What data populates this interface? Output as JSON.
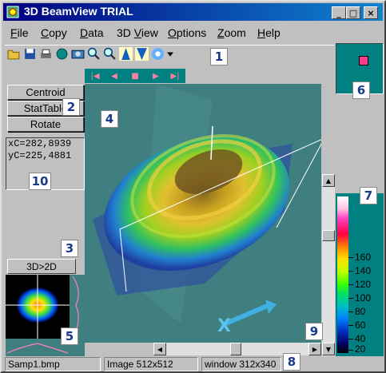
{
  "window": {
    "title": "3D BeamView TRIAL",
    "minimize": "_",
    "maximize": "□",
    "close": "×"
  },
  "menu": [
    "File",
    "Copy",
    "Data",
    "3D View",
    "Options",
    "Zoom",
    "Help"
  ],
  "menu_access_keys": [
    "F",
    "C",
    "D",
    "V",
    "O",
    "Z",
    "H"
  ],
  "toolbar": {
    "icons": [
      "open-icon",
      "save-icon",
      "print-icon",
      "globe-icon",
      "camera-icon",
      "zoom-in-icon",
      "zoom-out-icon",
      "beam-up-icon",
      "beam-split-icon",
      "star-icon",
      "dropdown-arrow-icon"
    ]
  },
  "callouts": [
    "1",
    "2",
    "3",
    "4",
    "5",
    "6",
    "7",
    "8",
    "9",
    "10"
  ],
  "left_panel": {
    "centroid": "Centroid",
    "stattable": "StatTable",
    "rotate": "Rotate",
    "xc": "xC=282,8939",
    "yc": "yC=225,4881",
    "btn_3d2d": "3D>2D"
  },
  "playback": {
    "first": "|◀",
    "prev": "◀",
    "stop": "■",
    "next": "▶",
    "last": "▶|"
  },
  "legend": {
    "labels": [
      "160",
      "140",
      "120",
      "100",
      "80",
      "60",
      "40",
      "20"
    ],
    "colors": {
      "top": "#ffffff",
      "high": "#ff0040",
      "mid": "#ffe000",
      "low": "#0030c0",
      "bottom": "#000000"
    }
  },
  "swatch": {
    "color": "#ff3c8c"
  },
  "statusbar": {
    "file": "Samp1.bmp",
    "image": "Image 512x512",
    "window": "window 312x340"
  },
  "colors": {
    "title_start": "#000080",
    "title_end": "#1084d0",
    "panel_teal": "#008080",
    "view_bg": "#3f7f7f",
    "callout_text": "#1a3a8c"
  }
}
